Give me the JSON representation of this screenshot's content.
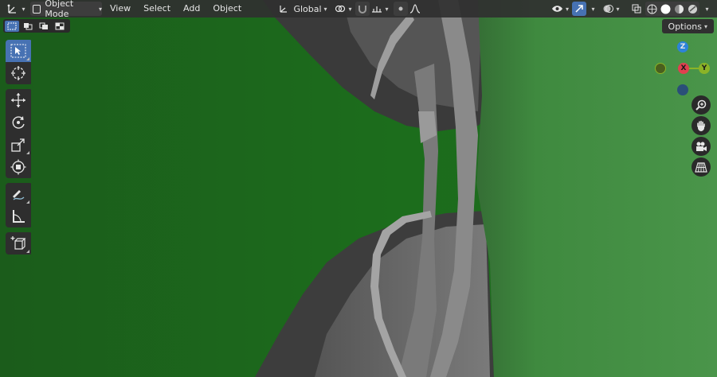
{
  "header": {
    "editor_type_icon": "axes-icon",
    "mode_label": "Object Mode",
    "menus": [
      "View",
      "Select",
      "Add",
      "Object"
    ],
    "transform_orientation": "Global"
  },
  "options_label": "Options",
  "gizmo": {
    "z": "Z",
    "x": "X",
    "y": "Y"
  },
  "colors": {
    "accent": "#4772b3",
    "axis_x": "#e0404f",
    "axis_y": "#8bb327",
    "axis_z": "#2d83d9",
    "background_green": "#1d5f1d"
  },
  "toolbar": {
    "tools": [
      "select-box",
      "cursor",
      "move",
      "rotate",
      "scale",
      "transform",
      "annotate",
      "measure",
      "add-cube"
    ],
    "active_tool": "select-box"
  },
  "nav_buttons": [
    "zoom",
    "pan",
    "camera",
    "ortho-grid"
  ]
}
